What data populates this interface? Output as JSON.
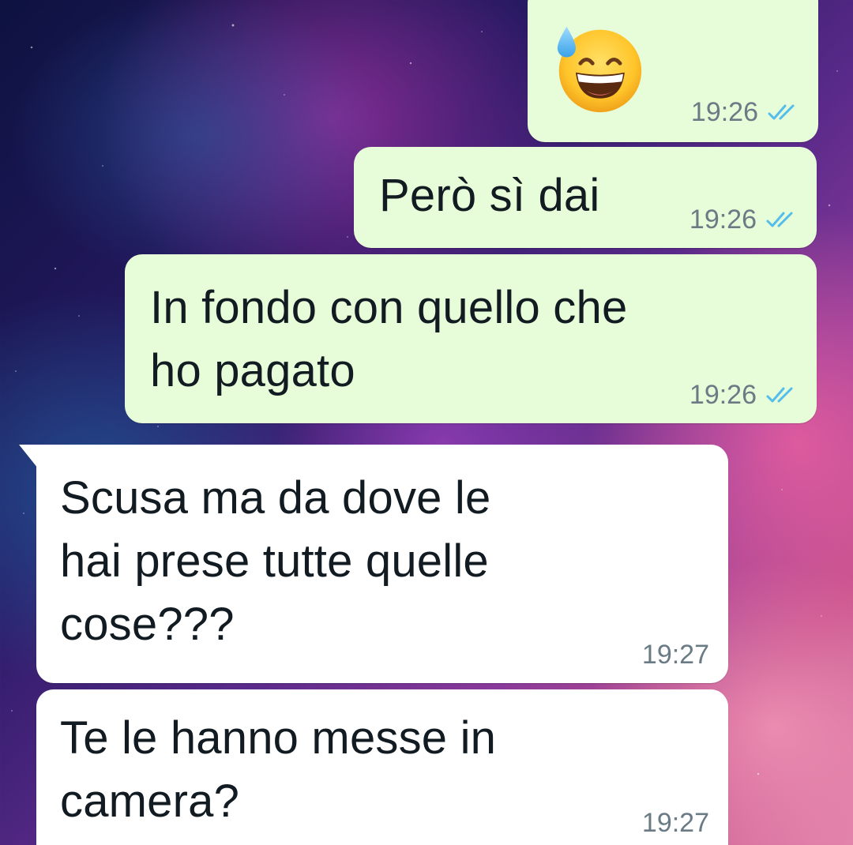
{
  "chat": {
    "messages": [
      {
        "direction": "outgoing",
        "emoji": "grinning-face-with-sweat",
        "time": "19:26",
        "status": "read",
        "status_color": "#53bdeb"
      },
      {
        "direction": "outgoing",
        "text": "Però sì dai",
        "time": "19:26",
        "status": "read",
        "status_color": "#53bdeb"
      },
      {
        "direction": "outgoing",
        "text": "In fondo con quello che\nho pagato",
        "time": "19:26",
        "status": "read",
        "status_color": "#53bdeb"
      },
      {
        "direction": "incoming",
        "text": "Scusa ma da dove le\nhai prese tutte quelle\ncose???",
        "time": "19:27"
      },
      {
        "direction": "incoming",
        "text": "Te le hanno messe in\ncamera?",
        "time": "19:27"
      }
    ]
  },
  "colors": {
    "outgoing_bubble": "#e7fcd8",
    "incoming_bubble": "#ffffff",
    "read_check": "#53bdeb",
    "timestamp": "#6a7b85"
  }
}
